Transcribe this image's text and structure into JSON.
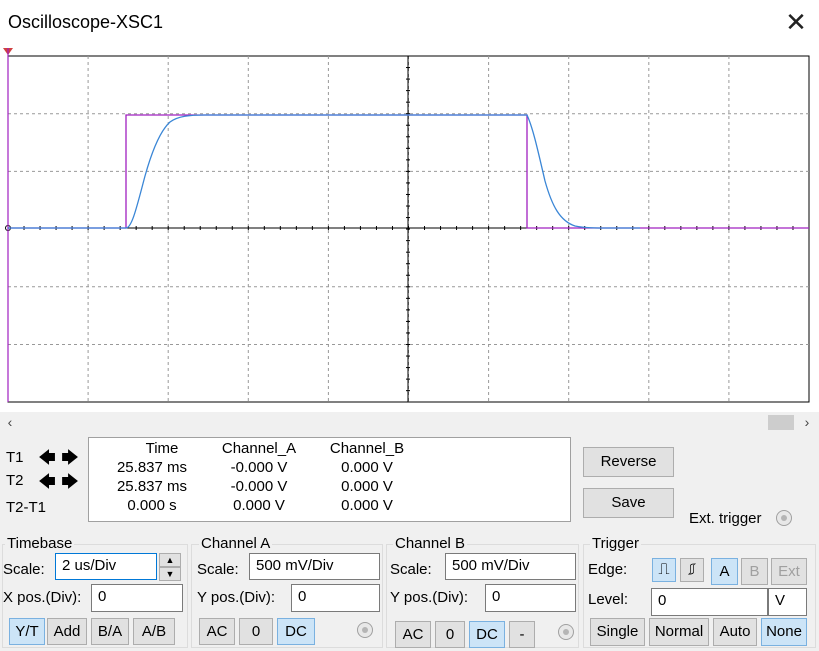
{
  "window": {
    "title": "Oscilloscope-XSC1",
    "close_glyph": "✕"
  },
  "scrollbar": {
    "left_glyph": "‹",
    "right_glyph": "›"
  },
  "cursors": {
    "t1_label": "T1",
    "t2_label": "T2",
    "diff_label": "T2-T1",
    "left_glyph": "🡄",
    "right_glyph": "🡆"
  },
  "readout": {
    "headers": [
      "Time",
      "Channel_A",
      "Channel_B"
    ],
    "rows": [
      [
        "25.837 ms",
        "-0.000 V",
        "0.000 V"
      ],
      [
        "25.837 ms",
        "-0.000 V",
        "0.000 V"
      ],
      [
        "0.000 s",
        "0.000 V",
        "0.000 V"
      ]
    ]
  },
  "buttons": {
    "reverse": "Reverse",
    "save": "Save",
    "ext_trigger": "Ext. trigger"
  },
  "timebase": {
    "title": "Timebase",
    "scale_label": "Scale:",
    "scale_value": "2 us/Div",
    "xpos_label": "X pos.(Div):",
    "xpos_value": "0",
    "modes": [
      "Y/T",
      "Add",
      "B/A",
      "A/B"
    ],
    "active_mode": "Y/T"
  },
  "channel_a": {
    "title": "Channel A",
    "scale_label": "Scale:",
    "scale_value": "500 mV/Div",
    "ypos_label": "Y pos.(Div):",
    "ypos_value": "0",
    "coupling": [
      "AC",
      "0",
      "DC"
    ],
    "active_coupling": "DC"
  },
  "channel_b": {
    "title": "Channel B",
    "scale_label": "Scale:",
    "scale_value": "500 mV/Div",
    "ypos_label": "Y pos.(Div):",
    "ypos_value": "0",
    "coupling": [
      "AC",
      "0",
      "DC",
      "-"
    ],
    "active_coupling": "DC"
  },
  "trigger": {
    "title": "Trigger",
    "edge_label": "Edge:",
    "level_label": "Level:",
    "level_value": "0",
    "level_unit": "V",
    "sources": [
      "A",
      "B",
      "Ext"
    ],
    "active_source": "A",
    "rising_glyph": "⎍",
    "falling_glyph": "⎎",
    "modes": [
      "Single",
      "Normal",
      "Auto",
      "None"
    ],
    "active_mode": "None"
  },
  "colors": {
    "channel_a_trace": "#a020c0",
    "channel_b_trace": "#3a86d6",
    "grid": "#999999"
  },
  "icons": {
    "trigger_marker": "trigger-marker-icon",
    "ground_marker": "ground-marker-icon"
  }
}
